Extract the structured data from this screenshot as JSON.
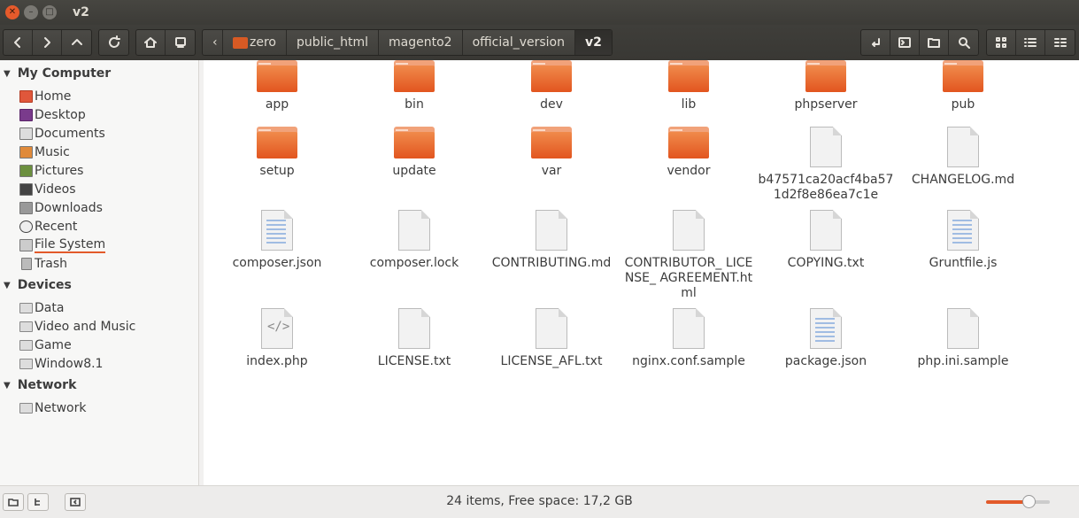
{
  "window": {
    "title": "v2"
  },
  "breadcrumbs": [
    {
      "label": "zero"
    },
    {
      "label": "public_html"
    },
    {
      "label": "magento2"
    },
    {
      "label": "official_version"
    },
    {
      "label": "v2"
    }
  ],
  "sidebar": {
    "sections": [
      {
        "title": "My Computer",
        "items": [
          "Home",
          "Desktop",
          "Documents",
          "Music",
          "Pictures",
          "Videos",
          "Downloads",
          "Recent",
          "File System",
          "Trash"
        ]
      },
      {
        "title": "Devices",
        "items": [
          "Data",
          "Video and Music",
          "Game",
          "Window8.1"
        ]
      },
      {
        "title": "Network",
        "items": [
          "Network"
        ]
      }
    ]
  },
  "files": [
    {
      "name": "app",
      "kind": "folder"
    },
    {
      "name": "bin",
      "kind": "folder"
    },
    {
      "name": "dev",
      "kind": "folder"
    },
    {
      "name": "lib",
      "kind": "folder"
    },
    {
      "name": "phpserver",
      "kind": "folder"
    },
    {
      "name": "pub",
      "kind": "folder"
    },
    {
      "name": "setup",
      "kind": "folder"
    },
    {
      "name": "update",
      "kind": "folder"
    },
    {
      "name": "var",
      "kind": "folder"
    },
    {
      "name": "vendor",
      "kind": "folder"
    },
    {
      "name": "b47571ca20acf4ba571d2f8e86ea7c1e",
      "kind": "doc"
    },
    {
      "name": "CHANGELOG.md",
      "kind": "doc"
    },
    {
      "name": "composer.json",
      "kind": "code"
    },
    {
      "name": "composer.lock",
      "kind": "doc"
    },
    {
      "name": "CONTRIBUTING.md",
      "kind": "doc"
    },
    {
      "name": "CONTRIBUTOR_ LICENSE_ AGREEMENT.html",
      "kind": "doc"
    },
    {
      "name": "COPYING.txt",
      "kind": "doc"
    },
    {
      "name": "Gruntfile.js",
      "kind": "code"
    },
    {
      "name": "index.php",
      "kind": "php"
    },
    {
      "name": "LICENSE.txt",
      "kind": "doc"
    },
    {
      "name": "LICENSE_AFL.txt",
      "kind": "doc"
    },
    {
      "name": "nginx.conf.sample",
      "kind": "doc"
    },
    {
      "name": "package.json",
      "kind": "code"
    },
    {
      "name": "php.ini.sample",
      "kind": "doc"
    }
  ],
  "status": {
    "text": "24 items, Free space: 17,2 GB",
    "zoom_level": 0.68
  },
  "colors": {
    "accent": "#e25a2a",
    "folder": "#ea6a2f",
    "titlebar": "#3c3b37"
  }
}
